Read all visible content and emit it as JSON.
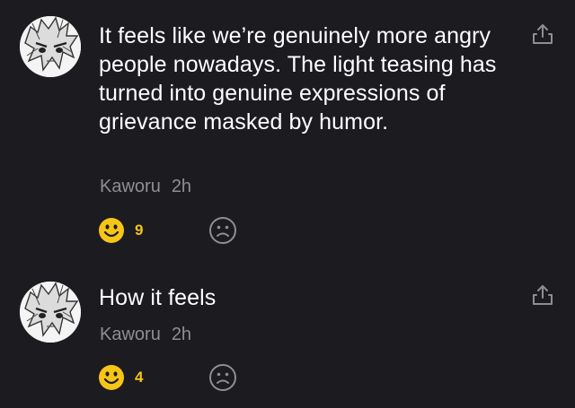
{
  "colors": {
    "background": "#1c1b20",
    "text": "#ffffff",
    "meta": "#8e8e93",
    "laugh": "#f5c518",
    "icon": "#8e8e93"
  },
  "comments": [
    {
      "text": "It feels like we’re genuinely more angry people nowadays. The light teasing has turned into genuine expressions of grievance masked by humor.",
      "author": "Kaworu",
      "time": "2h",
      "laugh_count": "9",
      "avatar_icon": "anime-avatar-icon",
      "share_icon": "share-icon",
      "laugh_icon": "laugh-emoji-icon",
      "sad_icon": "sad-face-icon"
    },
    {
      "text": "How it feels",
      "author": "Kaworu",
      "time": "2h",
      "laugh_count": "4",
      "avatar_icon": "anime-avatar-icon",
      "share_icon": "share-icon",
      "laugh_icon": "laugh-emoji-icon",
      "sad_icon": "sad-face-icon"
    }
  ]
}
